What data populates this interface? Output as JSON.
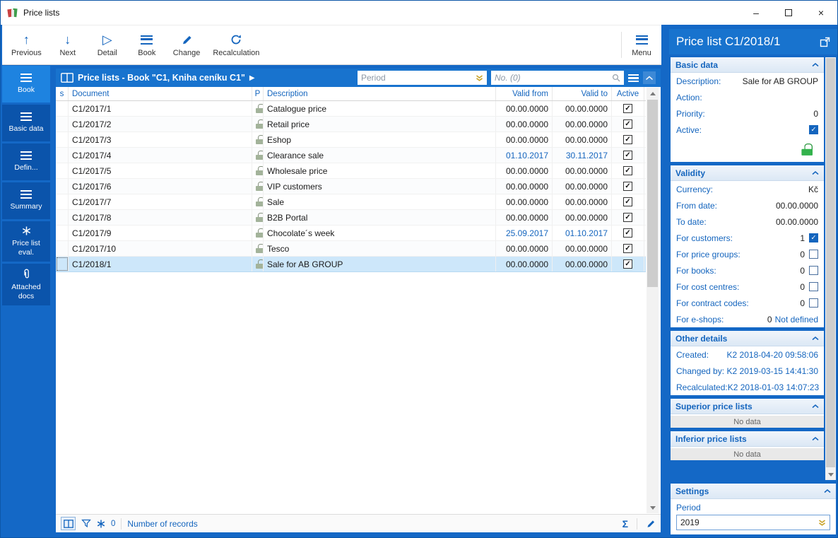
{
  "window": {
    "title": "Price lists",
    "minimize": "–",
    "close": "×"
  },
  "icons": {
    "previous": "↑",
    "next": "↓",
    "detail": "▷",
    "play": "▶",
    "check": "✓",
    "sigma": "Σ",
    "accent_color": "#1465BE",
    "gold_color": "#C9A227",
    "lock_green": "#33B24C"
  },
  "toolbar": {
    "buttons": [
      {
        "label": "Previous"
      },
      {
        "label": "Next"
      },
      {
        "label": "Detail"
      },
      {
        "label": "Book"
      },
      {
        "label": "Change"
      },
      {
        "label": "Recalculation"
      }
    ],
    "menu": "Menu"
  },
  "sidebar": {
    "items": [
      {
        "label": "Book",
        "active": true
      },
      {
        "label": "Basic data",
        "active": false
      },
      {
        "label": "Defin...",
        "active": false
      },
      {
        "label": "Summary",
        "active": false
      },
      {
        "label": "Price list eval.",
        "active": false
      },
      {
        "label": "Attached docs",
        "active": false
      }
    ]
  },
  "main": {
    "header": {
      "title": "Price lists - Book \"C1, Kniha ceníku C1\"",
      "period_placeholder": "Period",
      "search_placeholder": "No. (0)"
    },
    "table": {
      "columns": {
        "s": "s",
        "document": "Document",
        "p": "P",
        "description": "Description",
        "valid_from": "Valid from",
        "valid_to": "Valid to",
        "active": "Active"
      },
      "rows": [
        {
          "document": "C1/2017/1",
          "description": "Catalogue price",
          "valid_from": "00.00.0000",
          "valid_to": "00.00.0000",
          "active": true,
          "locked": true,
          "date_highlight": false,
          "selected": false
        },
        {
          "document": "C1/2017/2",
          "description": "Retail price",
          "valid_from": "00.00.0000",
          "valid_to": "00.00.0000",
          "active": true,
          "locked": true,
          "date_highlight": false,
          "selected": false
        },
        {
          "document": "C1/2017/3",
          "description": "Eshop",
          "valid_from": "00.00.0000",
          "valid_to": "00.00.0000",
          "active": true,
          "locked": true,
          "date_highlight": false,
          "selected": false
        },
        {
          "document": "C1/2017/4",
          "description": "Clearance sale",
          "valid_from": "01.10.2017",
          "valid_to": "30.11.2017",
          "active": true,
          "locked": true,
          "date_highlight": true,
          "selected": false
        },
        {
          "document": "C1/2017/5",
          "description": "Wholesale price",
          "valid_from": "00.00.0000",
          "valid_to": "00.00.0000",
          "active": true,
          "locked": true,
          "date_highlight": false,
          "selected": false
        },
        {
          "document": "C1/2017/6",
          "description": "VIP customers",
          "valid_from": "00.00.0000",
          "valid_to": "00.00.0000",
          "active": true,
          "locked": true,
          "date_highlight": false,
          "selected": false
        },
        {
          "document": "C1/2017/7",
          "description": "Sale",
          "valid_from": "00.00.0000",
          "valid_to": "00.00.0000",
          "active": true,
          "locked": true,
          "date_highlight": false,
          "selected": false
        },
        {
          "document": "C1/2017/8",
          "description": "B2B Portal",
          "valid_from": "00.00.0000",
          "valid_to": "00.00.0000",
          "active": true,
          "locked": true,
          "date_highlight": false,
          "selected": false
        },
        {
          "document": "C1/2017/9",
          "description": "Chocolate´s week",
          "valid_from": "25.09.2017",
          "valid_to": "01.10.2017",
          "active": true,
          "locked": true,
          "date_highlight": true,
          "selected": false
        },
        {
          "document": "C1/2017/10",
          "description": "Tesco",
          "valid_from": "00.00.0000",
          "valid_to": "00.00.0000",
          "active": true,
          "locked": true,
          "date_highlight": false,
          "selected": false
        },
        {
          "document": "C1/2018/1",
          "description": "Sale for AB GROUP",
          "valid_from": "00.00.0000",
          "valid_to": "00.00.0000",
          "active": true,
          "locked": true,
          "date_highlight": false,
          "selected": true
        }
      ]
    },
    "statusbar": {
      "counter": "0",
      "label": "Number of records"
    }
  },
  "panel": {
    "title": "Price list C1/2018/1",
    "sections": {
      "basic": {
        "title": "Basic data",
        "fields": [
          {
            "label": "Description:",
            "value": "Sale for AB GROUP"
          },
          {
            "label": "Action:",
            "value": ""
          },
          {
            "label": "Priority:",
            "value": "0"
          },
          {
            "label": "Active:",
            "value": "",
            "checkbox": "checked"
          }
        ]
      },
      "validity": {
        "title": "Validity",
        "fields": [
          {
            "label": "Currency:",
            "value": "Kč"
          },
          {
            "label": "From date:",
            "value": "00.00.0000"
          },
          {
            "label": "To date:",
            "value": "00.00.0000"
          },
          {
            "label": "For customers:",
            "value": "1",
            "checkbox": "checked"
          },
          {
            "label": "For price groups:",
            "value": "0",
            "checkbox": "unchecked"
          },
          {
            "label": "For books:",
            "value": "0",
            "checkbox": "unchecked"
          },
          {
            "label": "For cost centres:",
            "value": "0",
            "checkbox": "unchecked"
          },
          {
            "label": "For contract codes:",
            "value": "0",
            "checkbox": "unchecked"
          },
          {
            "label": "For e-shops:",
            "value": "0",
            "extra": "Not defined"
          }
        ]
      },
      "other": {
        "title": "Other details",
        "fields": [
          {
            "label": "Created:",
            "value": "K2 2018-04-20 09:58:06",
            "blue": true
          },
          {
            "label": "Changed by:",
            "value": "K2 2019-03-15 14:41:30",
            "blue": true
          },
          {
            "label": "Recalculated:",
            "value": "K2 2018-01-03 14:07:23",
            "blue": true
          }
        ]
      },
      "superior": {
        "title": "Superior price lists",
        "empty": "No data"
      },
      "inferior": {
        "title": "Inferior price lists",
        "empty": "No data"
      },
      "settings": {
        "title": "Settings",
        "period_label": "Period",
        "period_value": "2019"
      }
    }
  }
}
